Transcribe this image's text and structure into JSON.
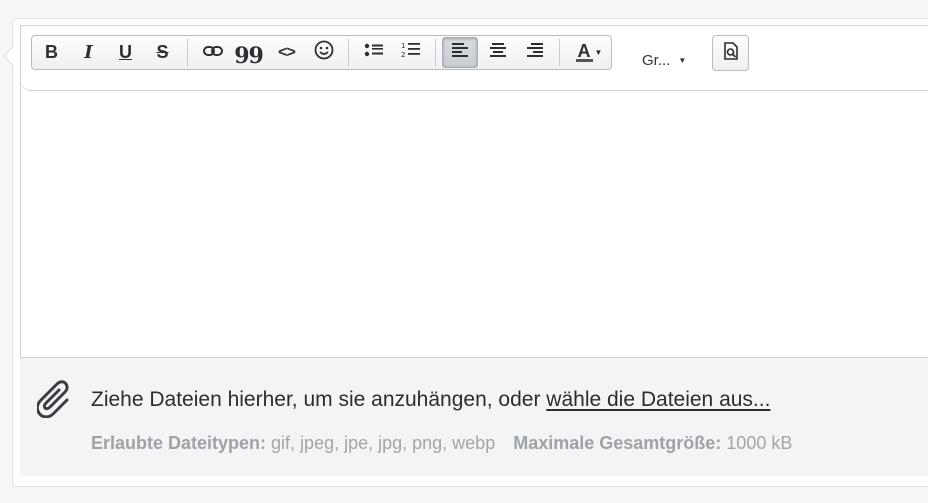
{
  "toolbar": {
    "buttons": [
      {
        "name": "bold",
        "icon": "bold-icon",
        "label": "B"
      },
      {
        "name": "italic",
        "icon": "italic-icon",
        "label": "I"
      },
      {
        "name": "underline",
        "icon": "underline-icon",
        "label": "U"
      },
      {
        "name": "strikethrough",
        "icon": "strikethrough-icon",
        "label": "S"
      },
      {
        "name": "link",
        "icon": "link-icon"
      },
      {
        "name": "quote",
        "icon": "quote-icon",
        "label": "99"
      },
      {
        "name": "code",
        "icon": "code-icon",
        "label": "<>"
      },
      {
        "name": "emoji",
        "icon": "smiley-icon"
      },
      {
        "name": "bullet-list",
        "icon": "bullet-list-icon"
      },
      {
        "name": "numbered-list",
        "icon": "numbered-list-icon"
      },
      {
        "name": "align-left",
        "icon": "align-left-icon",
        "active": true
      },
      {
        "name": "align-center",
        "icon": "align-center-icon"
      },
      {
        "name": "align-right",
        "icon": "align-right-icon"
      },
      {
        "name": "font-color",
        "icon": "font-color-icon",
        "label": "A"
      }
    ],
    "font_size_label": "Gr...",
    "preview_icon": "preview-icon"
  },
  "attachments": {
    "drop_text": "Ziehe Dateien hierher, um sie anzuhängen, oder ",
    "choose_link": "wähle die Dateien aus...",
    "allowed_label": "Erlaubte Dateitypen:",
    "allowed_value": " gif, jpeg, jpe, jpg, png, webp",
    "max_label": "Maximale Gesamtgröße:",
    "max_value": " 1000 kB",
    "icon": "paperclip-icon"
  },
  "colors": {
    "border": "#cfd3d8",
    "attach_bg": "#f2f4f6",
    "meta_text": "#a1a6ab"
  }
}
